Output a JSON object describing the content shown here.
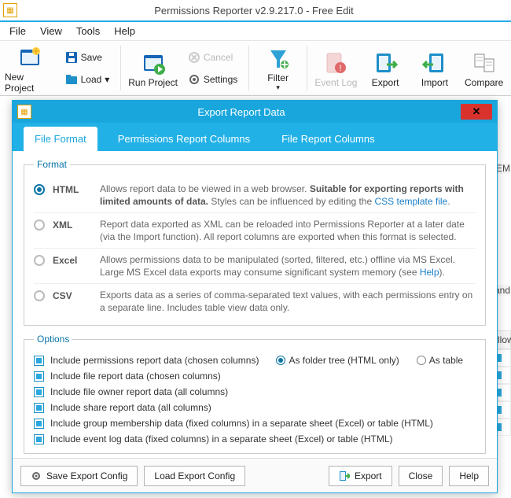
{
  "app": {
    "title": "Permissions Reporter v2.9.217.0 - Free Edit"
  },
  "menu": {
    "file": "File",
    "view": "View",
    "tools": "Tools",
    "help": "Help"
  },
  "ribbon": {
    "newProject": "New Project",
    "save": "Save",
    "load": "Load ",
    "runProject": "Run Project",
    "cancel": "Cancel",
    "settings": "Settings",
    "filter": "Filter",
    "eventLog": "Event Log",
    "export": "Export",
    "import": "Import",
    "compare": "Compare"
  },
  "bg": {
    "em": "EM",
    "and": ", and",
    "allow": "Allow"
  },
  "dialog": {
    "title": "Export Report Data",
    "tabs": {
      "fileFormat": "File Format",
      "permCols": "Permissions Report Columns",
      "fileCols": "File Report Columns"
    },
    "formatLegend": "Format",
    "formats": {
      "html": {
        "name": "HTML",
        "desc_a": "Allows report data to be viewed in a web browser. ",
        "desc_b": "Suitable for exporting reports with limited amounts of data.",
        "desc_c": " Styles can be influenced by editing the ",
        "link": "CSS template file",
        "desc_d": "."
      },
      "xml": {
        "name": "XML",
        "desc": "Report data exported as XML can be reloaded into Permissions Reporter at a later date (via the Import function). All report columns are exported when this format is selected."
      },
      "excel": {
        "name": "Excel",
        "desc_a": "Allows permissions data to be manipulated (sorted, filtered, etc.) offline via MS Excel. Large MS Excel data exports may consume significant system memory (see ",
        "link": "Help",
        "desc_b": ")."
      },
      "csv": {
        "name": "CSV",
        "desc": "Exports data as a series of comma-separated text values, with each permissions entry on a separate line. Includes table view data only."
      }
    },
    "optionsLegend": "Options",
    "options": {
      "perm": "Include permissions report data (chosen columns)",
      "folderTree": "As folder tree (HTML only)",
      "asTable": "As table",
      "file": "Include file report data (chosen columns)",
      "owner": "Include file owner report data (all columns)",
      "share": "Include share report data (all columns)",
      "group": "Include group membership data (fixed columns) in a separate sheet (Excel) or table (HTML)",
      "eventlog": "Include event log data (fixed columns) in a separate sheet (Excel) or table (HTML)"
    },
    "buttons": {
      "saveCfg": "Save Export Config",
      "loadCfg": "Load Export Config",
      "export": "Export",
      "close": "Close",
      "help": "Help"
    }
  }
}
